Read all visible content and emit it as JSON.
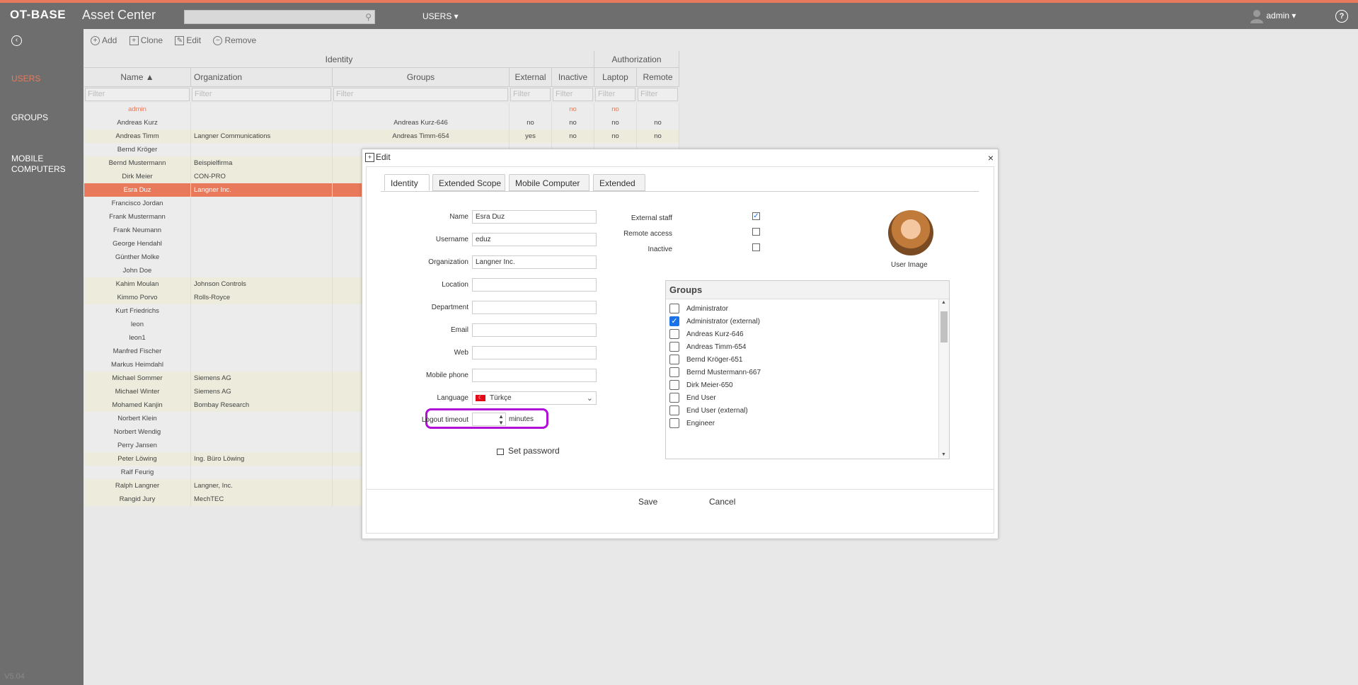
{
  "app": {
    "brand": "OT-BASE",
    "subtitle": "Asset Center",
    "menu_users": "USERS ▾",
    "user": "admin ▾",
    "help": "?",
    "version": "V5.04"
  },
  "sidebar": {
    "items": [
      {
        "label": "USERS"
      },
      {
        "label": "GROUPS"
      },
      {
        "label": "MOBILE COMPUTERS"
      }
    ]
  },
  "toolbar": {
    "add": "Add",
    "clone": "Clone",
    "edit": "Edit",
    "remove": "Remove"
  },
  "grid": {
    "group_identity": "Identity",
    "group_authorization": "Authorization",
    "columns": [
      "Name ▲",
      "Organization",
      "Groups",
      "External",
      "Inactive",
      "Laptop",
      "Remote"
    ],
    "filter_placeholder": "Filter",
    "rows": [
      {
        "name": "admin",
        "org": "",
        "groups": "",
        "external": "",
        "inactive": "no",
        "laptop": "no",
        "remote": ""
      },
      {
        "name": "Andreas Kurz",
        "org": "",
        "groups": "Andreas Kurz-646",
        "external": "no",
        "inactive": "no",
        "laptop": "no",
        "remote": "no"
      },
      {
        "name": "Andreas Timm",
        "org": "Langner Communications",
        "groups": "Andreas Timm-654",
        "external": "yes",
        "inactive": "no",
        "laptop": "no",
        "remote": "no"
      },
      {
        "name": "Bernd Kröger",
        "org": "",
        "groups": "",
        "external": "",
        "inactive": "",
        "laptop": "",
        "remote": ""
      },
      {
        "name": "Bernd Mustermann",
        "org": "Beispielfirma",
        "groups": "",
        "external": "",
        "inactive": "",
        "laptop": "",
        "remote": ""
      },
      {
        "name": "Dirk Meier",
        "org": "CON-PRO",
        "groups": "",
        "external": "",
        "inactive": "",
        "laptop": "",
        "remote": ""
      },
      {
        "name": "Esra Duz",
        "org": "Langner Inc.",
        "groups": "",
        "external": "",
        "inactive": "",
        "laptop": "",
        "remote": ""
      },
      {
        "name": "Francisco Jordan",
        "org": "",
        "groups": "",
        "external": "",
        "inactive": "",
        "laptop": "",
        "remote": ""
      },
      {
        "name": "Frank Mustermann",
        "org": "",
        "groups": "",
        "external": "",
        "inactive": "",
        "laptop": "",
        "remote": ""
      },
      {
        "name": "Frank Neumann",
        "org": "",
        "groups": "",
        "external": "",
        "inactive": "",
        "laptop": "",
        "remote": ""
      },
      {
        "name": "George Hendahl",
        "org": "",
        "groups": "",
        "external": "",
        "inactive": "",
        "laptop": "",
        "remote": ""
      },
      {
        "name": "Günther Molke",
        "org": "",
        "groups": "",
        "external": "",
        "inactive": "",
        "laptop": "",
        "remote": ""
      },
      {
        "name": "John Doe",
        "org": "",
        "groups": "",
        "external": "",
        "inactive": "",
        "laptop": "",
        "remote": ""
      },
      {
        "name": "Kahim Moulan",
        "org": "Johnson Controls",
        "groups": "",
        "external": "",
        "inactive": "",
        "laptop": "",
        "remote": ""
      },
      {
        "name": "Kimmo Porvo",
        "org": "Rolls-Royce",
        "groups": "",
        "external": "",
        "inactive": "",
        "laptop": "",
        "remote": ""
      },
      {
        "name": "Kurt Friedrichs",
        "org": "",
        "groups": "",
        "external": "",
        "inactive": "",
        "laptop": "",
        "remote": ""
      },
      {
        "name": "leon",
        "org": "",
        "groups": "",
        "external": "",
        "inactive": "",
        "laptop": "",
        "remote": ""
      },
      {
        "name": "leon1",
        "org": "",
        "groups": "",
        "external": "",
        "inactive": "",
        "laptop": "",
        "remote": ""
      },
      {
        "name": "Manfred Fischer",
        "org": "",
        "groups": "",
        "external": "",
        "inactive": "",
        "laptop": "",
        "remote": ""
      },
      {
        "name": "Markus Heimdahl",
        "org": "",
        "groups": "",
        "external": "",
        "inactive": "",
        "laptop": "",
        "remote": ""
      },
      {
        "name": "Michael Sommer",
        "org": "Siemens AG",
        "groups": "",
        "external": "",
        "inactive": "",
        "laptop": "",
        "remote": ""
      },
      {
        "name": "Michael Winter",
        "org": "Siemens AG",
        "groups": "",
        "external": "",
        "inactive": "",
        "laptop": "",
        "remote": ""
      },
      {
        "name": "Mohamed Kanjin",
        "org": "Bombay Research",
        "groups": "",
        "external": "",
        "inactive": "",
        "laptop": "",
        "remote": ""
      },
      {
        "name": "Norbert Klein",
        "org": "",
        "groups": "",
        "external": "",
        "inactive": "",
        "laptop": "",
        "remote": ""
      },
      {
        "name": "Norbert Wendig",
        "org": "",
        "groups": "",
        "external": "",
        "inactive": "",
        "laptop": "",
        "remote": ""
      },
      {
        "name": "Perry Jansen",
        "org": "",
        "groups": "",
        "external": "",
        "inactive": "",
        "laptop": "",
        "remote": ""
      },
      {
        "name": "Peter Löwing",
        "org": "Ing. Büro Löwing",
        "groups": "",
        "external": "",
        "inactive": "",
        "laptop": "",
        "remote": ""
      },
      {
        "name": "Ralf Feurig",
        "org": "",
        "groups": "",
        "external": "",
        "inactive": "",
        "laptop": "",
        "remote": ""
      },
      {
        "name": "Ralph Langner",
        "org": "Langner, Inc.",
        "groups": "",
        "external": "",
        "inactive": "",
        "laptop": "",
        "remote": ""
      },
      {
        "name": "Rangid Jury",
        "org": "MechTEC",
        "groups": "",
        "external": "",
        "inactive": "",
        "laptop": "",
        "remote": ""
      }
    ]
  },
  "dialog": {
    "title": "Edit",
    "close": "×",
    "tabs": [
      "Identity",
      "Extended Scope",
      "Mobile Computer",
      "Extended"
    ],
    "fields": {
      "name_label": "Name",
      "name_value": "Esra Duz",
      "username_label": "Username",
      "username_value": "eduz",
      "org_label": "Organization",
      "org_value": "Langner Inc.",
      "location_label": "Location",
      "location_value": "",
      "department_label": "Department",
      "department_value": "",
      "email_label": "Email",
      "email_value": "",
      "web_label": "Web",
      "web_value": "",
      "mobile_label": "Mobile phone",
      "mobile_value": "",
      "language_label": "Language",
      "language_value": "Türkçe",
      "timeout_label": "Logout timeout",
      "timeout_value": "",
      "timeout_unit": "minutes"
    },
    "set_password": "Set password",
    "checks": {
      "external_label": "External staff",
      "external": true,
      "remote_label": "Remote access",
      "remote": false,
      "inactive_label": "Inactive",
      "inactive": false
    },
    "user_image_label": "User Image",
    "groups_title": "Groups",
    "groups": [
      {
        "label": "Administrator",
        "checked": false
      },
      {
        "label": "Administrator (external)",
        "checked": true
      },
      {
        "label": "Andreas Kurz-646",
        "checked": false
      },
      {
        "label": "Andreas Timm-654",
        "checked": false
      },
      {
        "label": "Bernd Kröger-651",
        "checked": false
      },
      {
        "label": "Bernd Mustermann-667",
        "checked": false
      },
      {
        "label": "Dirk Meier-650",
        "checked": false
      },
      {
        "label": "End User",
        "checked": false
      },
      {
        "label": "End User (external)",
        "checked": false
      },
      {
        "label": "Engineer",
        "checked": false
      }
    ],
    "save": "Save",
    "cancel": "Cancel"
  },
  "colors": {
    "accent": "#e8795a",
    "highlight": "#b10ed8",
    "check": "#1a73e8"
  }
}
